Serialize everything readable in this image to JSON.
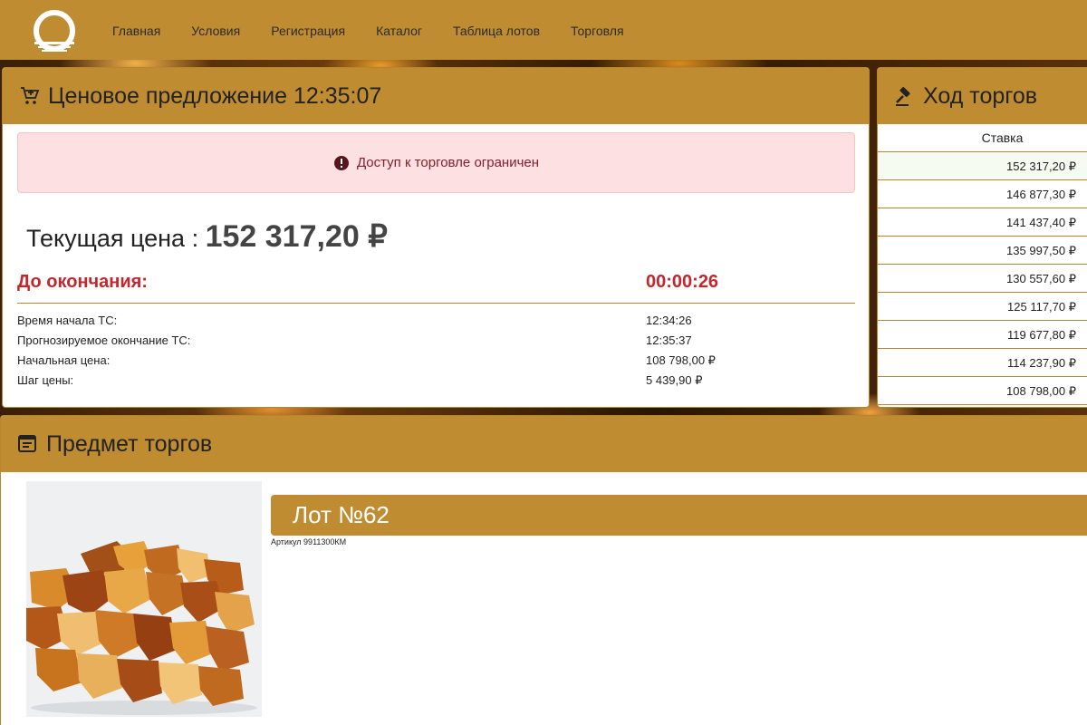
{
  "nav": {
    "items": [
      "Главная",
      "Условия",
      "Регистрация",
      "Каталог",
      "Таблица лотов",
      "Торговля"
    ]
  },
  "offer": {
    "title": "Ценовое предложение 12:35:07",
    "alert": "Доступ к торговле ограничен",
    "current_price_label": "Текущая цена :",
    "current_price_value": "152 317,20 ₽",
    "until_label": "До окончания:",
    "until_value": "00:00:26",
    "info": [
      {
        "label": "Время начала ТС:",
        "value": "12:34:26"
      },
      {
        "label": "Прогнозируемое окончание ТС:",
        "value": "12:35:37"
      },
      {
        "label": "Начальная цена:",
        "value": "108 798,00 ₽"
      },
      {
        "label": "Шаг цены:",
        "value": "5 439,90 ₽"
      }
    ]
  },
  "bids": {
    "title": "Ход торгов",
    "column": "Ставка",
    "rows": [
      "152 317,20 ₽",
      "146 877,30 ₽",
      "141 437,40 ₽",
      "135 997,50 ₽",
      "130 557,60 ₽",
      "125 117,70 ₽",
      "119 677,80 ₽",
      "114 237,90 ₽",
      "108 798,00 ₽"
    ]
  },
  "subject": {
    "title": "Предмет торгов",
    "lot_title": "Лот №62",
    "sku": "Артикул 9911300КМ"
  },
  "colors": {
    "brand": "#c08c32",
    "alert_bg": "#fde0e2",
    "alert_text": "#842029",
    "countdown": "#c1272d"
  }
}
